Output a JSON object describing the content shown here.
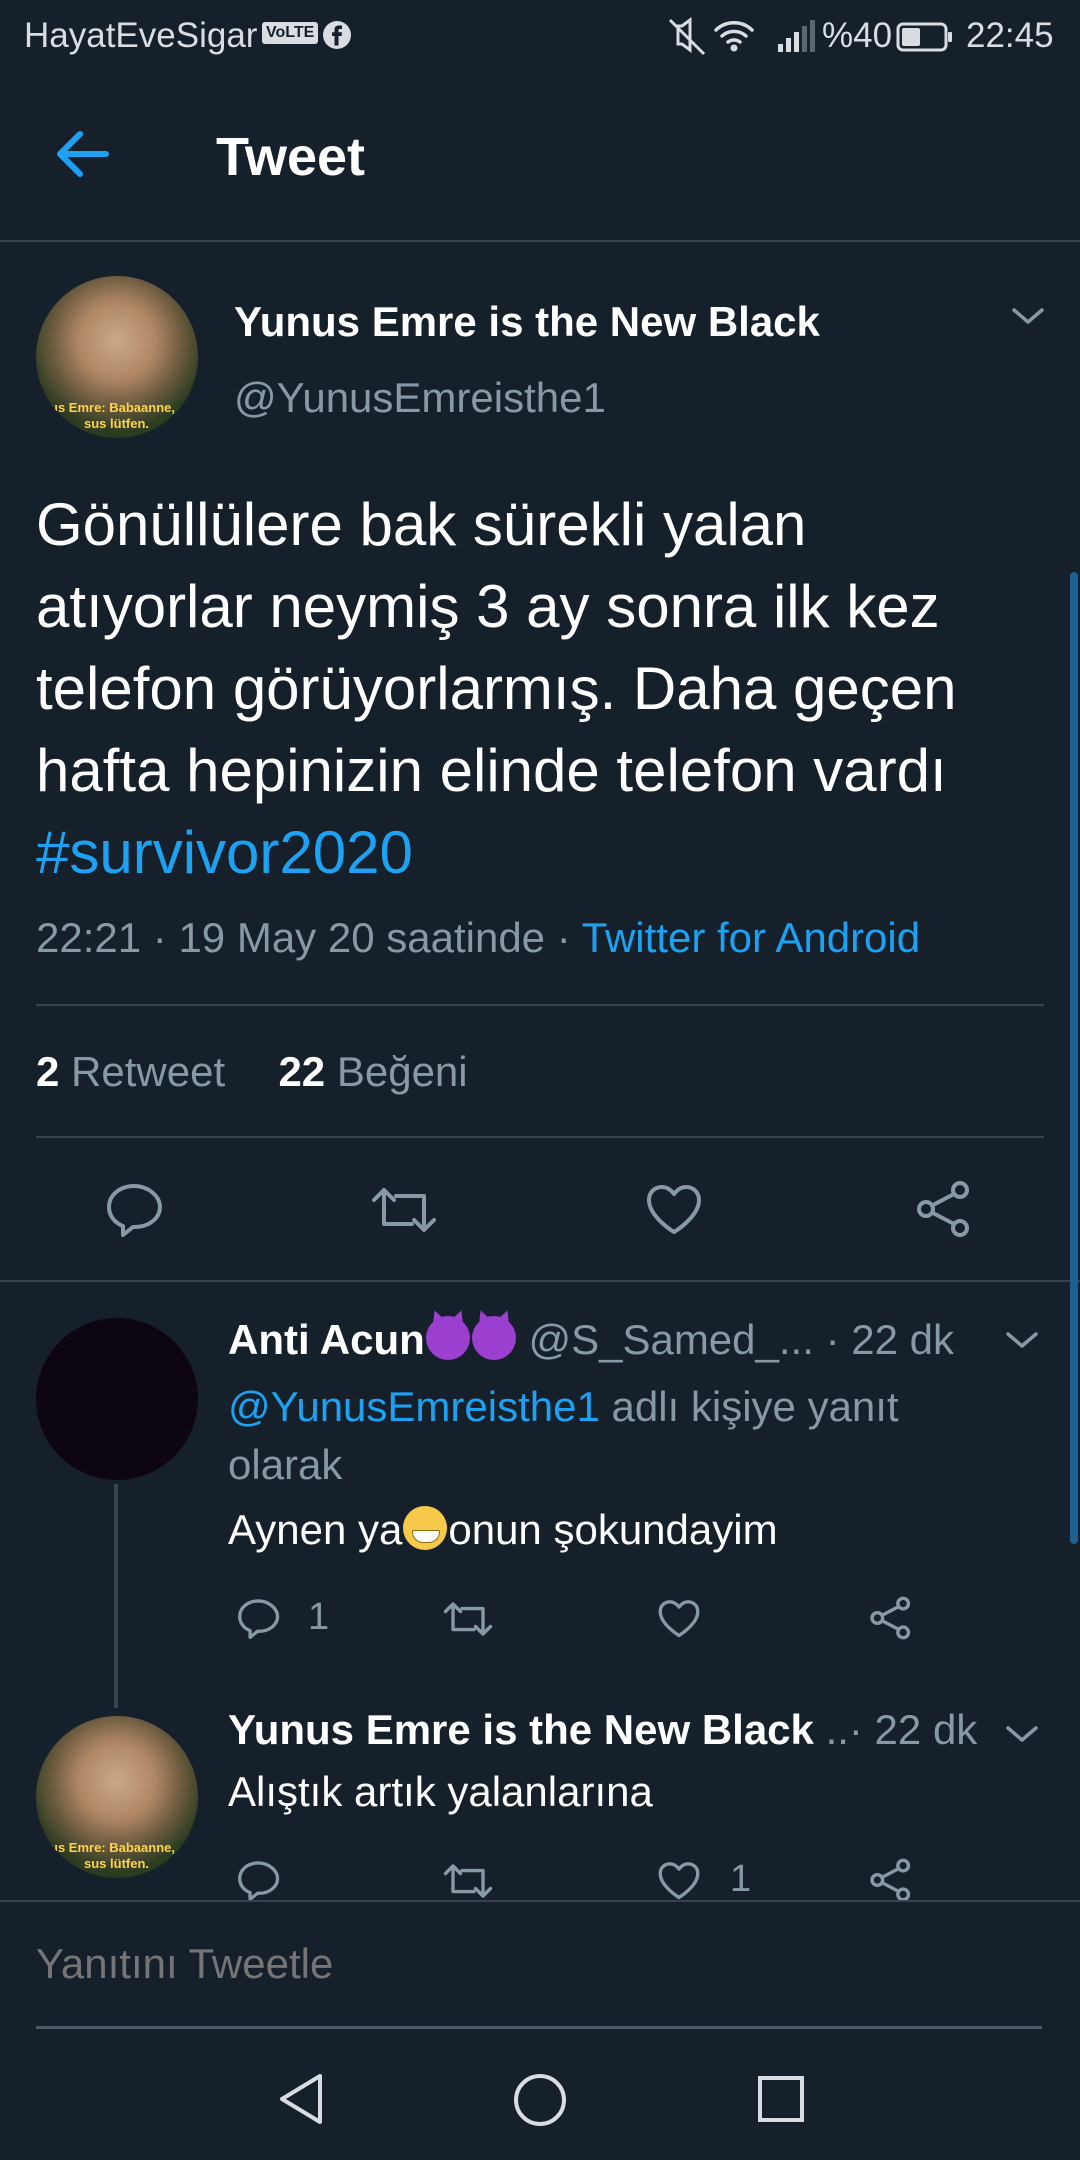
{
  "status_bar": {
    "carrier": "HayatEveSigar",
    "volte": "VoLTE",
    "battery": "%40",
    "time": "22:45",
    "icons": [
      "facebook-icon",
      "mute-icon",
      "wifi-icon",
      "signal-icon",
      "battery-icon"
    ]
  },
  "header": {
    "title": "Tweet",
    "back_icon": "back-arrow-icon"
  },
  "tweet": {
    "display_name": "Yunus Emre is the New Black",
    "handle": "@YunusEmreisthe1",
    "avatar_caption_1": "us Emre: Babaanne,",
    "avatar_caption_2": "sus lütfen.",
    "text_lines": [
      "Gönüllülere bak sürekli yalan",
      "atıyorlar neymiş 3 ay sonra ilk kez",
      "telefon görüyorlarmış. Daha geçen",
      "hafta hepinizin elinde telefon vardı"
    ],
    "hashtag": "#survivor2020",
    "time": "22:21",
    "date": "19 May 20 saatinde",
    "source": "Twitter for Android",
    "retweet_count": "2",
    "retweet_label": "Retweet",
    "like_count": "22",
    "like_label": "Beğeni"
  },
  "replies": [
    {
      "display_name": "Anti Acun",
      "handle": "@S_Samed_...",
      "age": "· 22 dk",
      "reply_to": "@YunusEmreisthe1",
      "reply_suffix": " adlı kişiye yanıt",
      "reply_suffix_2": "olarak",
      "text_before": "Aynen ya",
      "text_after": "onun şokundayim",
      "reply_count": "1"
    },
    {
      "display_name": "Yunus Emre is the New Black",
      "handle_trunc": "..",
      "age": "· 22 dk",
      "text": "Alıştık artık yalanlarına",
      "like_count": "1"
    }
  ],
  "reply_bar": {
    "placeholder": "Yanıtını Tweetle"
  },
  "colors": {
    "background": "#15202b",
    "accent": "#1da1f2",
    "muted": "#8899a6",
    "divider": "#38444d"
  }
}
